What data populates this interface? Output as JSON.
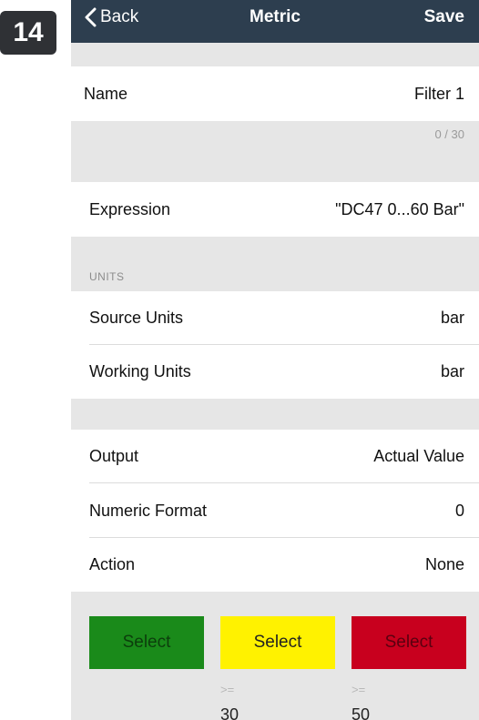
{
  "step_badge": "14",
  "nav": {
    "back_label": "Back",
    "title": "Metric",
    "save_label": "Save"
  },
  "name_row": {
    "label": "Name",
    "value": "Filter 1"
  },
  "name_counter": "0 / 30",
  "expression_row": {
    "label": "Expression",
    "value": "\"DC47 0...60 Bar\""
  },
  "units_header": "UNITS",
  "source_units": {
    "label": "Source Units",
    "value": "bar"
  },
  "working_units": {
    "label": "Working Units",
    "value": "bar"
  },
  "output_row": {
    "label": "Output",
    "value": "Actual Value"
  },
  "numeric_format_row": {
    "label": "Numeric Format",
    "value": "0"
  },
  "action_row": {
    "label": "Action",
    "value": "None"
  },
  "color_buttons": [
    {
      "label": "Select",
      "color": "#1a8a1a",
      "text_color": "#0c3d0c"
    },
    {
      "label": "Select",
      "color": "#fff200",
      "text_color": "#222222"
    },
    {
      "label": "Select",
      "color": "#c8001e",
      "text_color": "#5a0010"
    }
  ],
  "thresholds": [
    {
      "op": ">=",
      "value": "30"
    },
    {
      "op": ">=",
      "value": "50"
    }
  ]
}
